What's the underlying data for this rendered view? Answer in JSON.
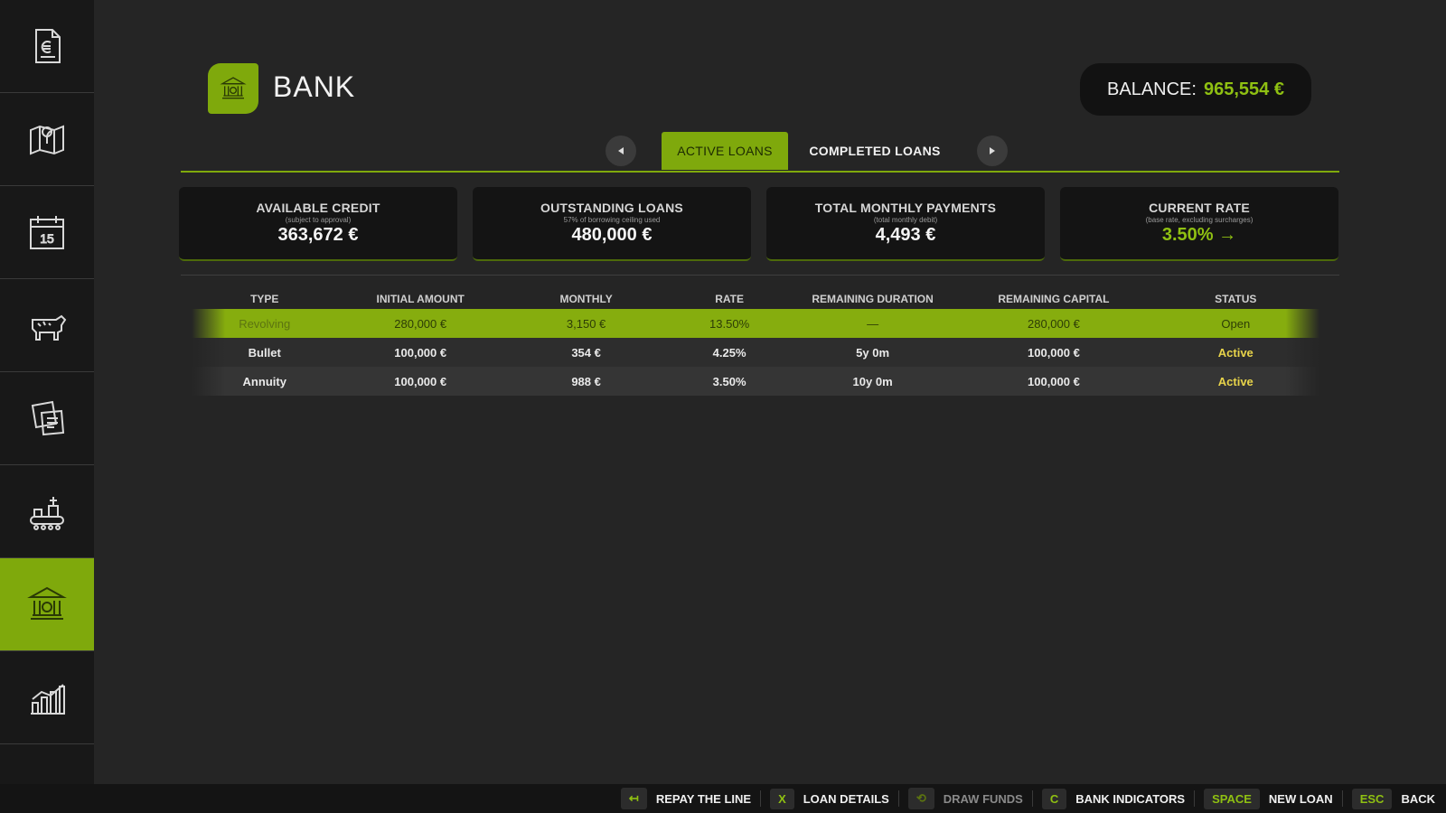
{
  "header": {
    "title": "BANK",
    "balance_label": "BALANCE:",
    "balance_value": "965,554 €"
  },
  "tabs": {
    "active": "ACTIVE LOANS",
    "completed": "COMPLETED LOANS"
  },
  "cards": [
    {
      "title": "AVAILABLE CREDIT",
      "subtitle": "(subject to approval)",
      "value": "363,672 €"
    },
    {
      "title": "OUTSTANDING LOANS",
      "subtitle": "57% of borrowing ceiling used",
      "value": "480,000 €"
    },
    {
      "title": "TOTAL MONTHLY PAYMENTS",
      "subtitle": "(total monthly debit)",
      "value": "4,493 €"
    },
    {
      "title": "CURRENT RATE",
      "subtitle": "(base rate, excluding surcharges)",
      "value": "3.50% →"
    }
  ],
  "table": {
    "headers": [
      "TYPE",
      "INITIAL AMOUNT",
      "MONTHLY",
      "RATE",
      "REMAINING DURATION",
      "REMAINING CAPITAL",
      "STATUS"
    ],
    "rows": [
      [
        "Revolving",
        "280,000 €",
        "3,150 €",
        "13.50%",
        "—",
        "280,000 €",
        "Open"
      ],
      [
        "Bullet",
        "100,000 €",
        "354 €",
        "4.25%",
        "5y 0m",
        "100,000 €",
        "Active"
      ],
      [
        "Annuity",
        "100,000 €",
        "988 €",
        "3.50%",
        "10y 0m",
        "100,000 €",
        "Active"
      ]
    ]
  },
  "sidebar": {
    "icons": [
      "invoice-icon",
      "map-icon",
      "calendar-icon",
      "livestock-icon",
      "contracts-icon",
      "production-icon",
      "bank-icon",
      "statistics-icon",
      "more-icon"
    ],
    "calendar_day": "15"
  },
  "footer": [
    {
      "key": "↤",
      "label": "REPAY THE LINE"
    },
    {
      "key": "X",
      "label": "LOAN DETAILS"
    },
    {
      "key": "⟲",
      "label": "DRAW FUNDS"
    },
    {
      "key": "C",
      "label": "BANK INDICATORS"
    },
    {
      "key": "SPACE",
      "label": "NEW LOAN"
    },
    {
      "key": "ESC",
      "label": "BACK"
    }
  ],
  "colors": {
    "accent": "#7fa90c",
    "balance": "#8fc012",
    "status_active": "#e8d44a"
  }
}
